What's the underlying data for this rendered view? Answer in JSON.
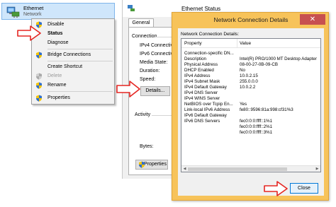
{
  "adapter": {
    "name": "Ethernet",
    "subtitle": "Network"
  },
  "context_menu": {
    "items": [
      {
        "label": "Disable",
        "icon": "shield-icon",
        "bold": false,
        "disabled": false
      },
      {
        "label": "Status",
        "icon": "",
        "bold": true,
        "disabled": false
      },
      {
        "label": "Diagnose",
        "icon": "",
        "bold": false,
        "disabled": false
      },
      {
        "label": "Bridge Connections",
        "icon": "shield-icon",
        "bold": false,
        "disabled": false
      },
      {
        "label": "Create Shortcut",
        "icon": "",
        "bold": false,
        "disabled": false
      },
      {
        "label": "Delete",
        "icon": "shield-icon",
        "bold": false,
        "disabled": true
      },
      {
        "label": "Rename",
        "icon": "shield-icon",
        "bold": false,
        "disabled": false
      },
      {
        "label": "Properties",
        "icon": "shield-icon",
        "bold": false,
        "disabled": false
      }
    ]
  },
  "status_window": {
    "title": "Ethernet Status",
    "tab": "General",
    "connection_label": "Connection",
    "ipv4_label": "IPv4 Connectivi",
    "ipv6_label": "IPv6 Connectivi",
    "media_label": "Media State:",
    "duration_label": "Duration:",
    "speed_label": "Speed:",
    "details_button": "Details...",
    "activity_label": "Activity",
    "bytes_label": "Bytes:",
    "properties_button": "Properties"
  },
  "details_dialog": {
    "title": "Network Connection Details",
    "close_x": "✕",
    "list_label": "Network Connection Details:",
    "columns": [
      "Property",
      "Value"
    ],
    "rows": [
      [
        "Connection-specific DN...",
        ""
      ],
      [
        "Description",
        "Intel(R) PRO/1000 MT Desktop Adapter"
      ],
      [
        "Physical Address",
        "08-00-27-0B-09-CB"
      ],
      [
        "DHCP Enabled",
        "No"
      ],
      [
        "IPv4 Address",
        "10.0.2.15"
      ],
      [
        "IPv4 Subnet Mask",
        "255.0.0.0"
      ],
      [
        "IPv4 Default Gateway",
        "10.0.2.2"
      ],
      [
        "IPv4 DNS Server",
        ""
      ],
      [
        "IPv4 WINS Server",
        ""
      ],
      [
        "NetBIOS over Tcpip En...",
        "Yes"
      ],
      [
        "Link-local IPv6 Address",
        "fe80::9596:81a:998:cf31%3"
      ],
      [
        "IPv6 Default Gateway",
        ""
      ],
      [
        "IPv6 DNS Servers",
        "fec0:0:0:ffff::1%1"
      ],
      [
        "",
        "fec0:0:0:ffff::2%1"
      ],
      [
        "",
        "fec0:0:0:ffff::3%1"
      ]
    ],
    "close_button": "Close"
  },
  "colors": {
    "highlight_arrow": "#e52521",
    "dialog_frame": "#f7c35a",
    "selection_bg": "#cfe6fb"
  }
}
